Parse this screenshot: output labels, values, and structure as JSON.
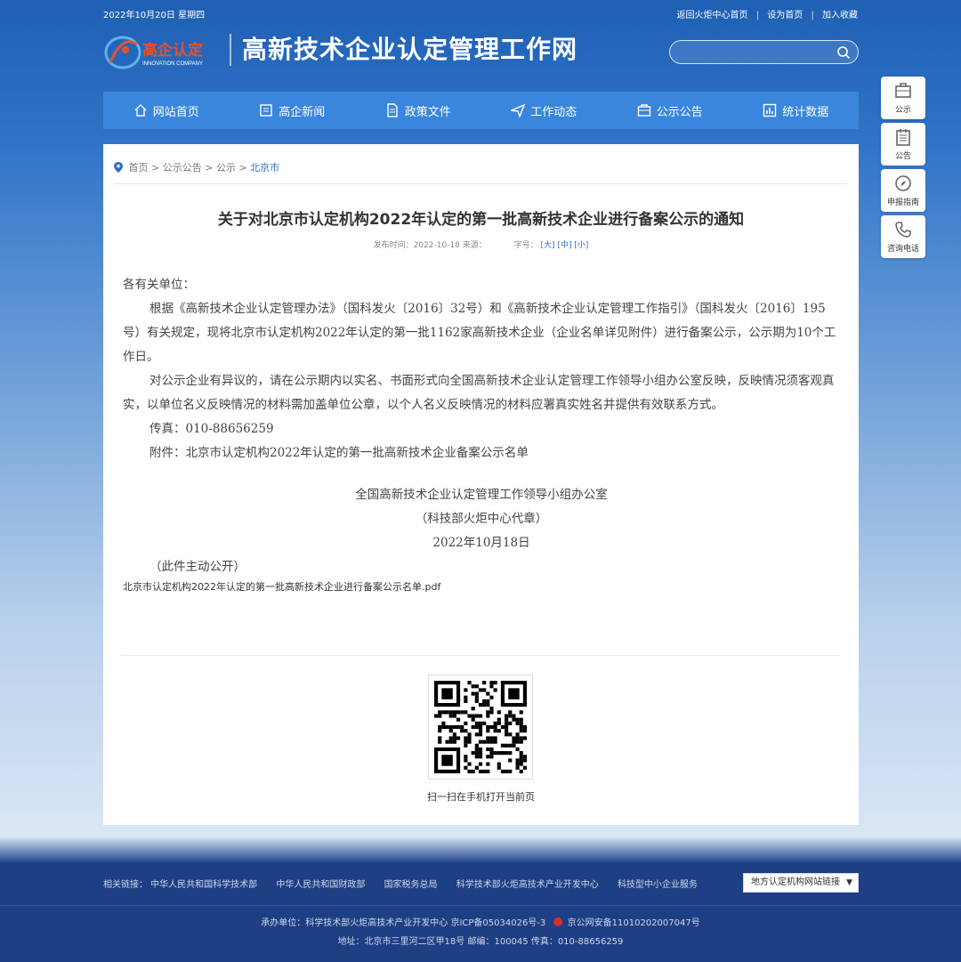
{
  "topbar": {
    "date": "2022年10月20日 星期四",
    "links": [
      "返回火炬中心首页",
      "设为首页",
      "加入收藏"
    ]
  },
  "header": {
    "logo_text": "高企认定",
    "logo_sub": "INNOVATION COMPANY",
    "site_title": "高新技术企业认定管理工作网",
    "search_placeholder": ""
  },
  "nav": [
    {
      "label": "网站首页",
      "icon": "home-icon"
    },
    {
      "label": "高企新闻",
      "icon": "news-icon"
    },
    {
      "label": "政策文件",
      "icon": "document-icon"
    },
    {
      "label": "工作动态",
      "icon": "send-icon"
    },
    {
      "label": "公示公告",
      "icon": "briefcase-icon"
    },
    {
      "label": "统计数据",
      "icon": "chart-icon"
    }
  ],
  "sidebar": [
    {
      "label": "公示",
      "icon": "briefcase-icon"
    },
    {
      "label": "公告",
      "icon": "notice-icon"
    },
    {
      "label": "申报指南",
      "icon": "compass-icon"
    },
    {
      "label": "咨询电话",
      "icon": "phone-icon"
    }
  ],
  "breadcrumb": {
    "items": [
      "首页",
      "公示公告",
      "公示"
    ],
    "current": "北京市",
    "sep": ">"
  },
  "article": {
    "title": "关于对北京市认定机构2022年认定的第一批高新技术企业进行备案公示的通知",
    "meta_date": "发布时间：2022-10-18 来源：",
    "font_label": "字号：",
    "font_sizes": [
      "[大]",
      "[中]",
      "[小]"
    ],
    "greeting": "各有关单位：",
    "para1": "根据《高新技术企业认定管理办法》（国科发火〔2016〕32号）和《高新技术企业认定管理工作指引》（国科发火〔2016〕195号）有关规定，现将北京市认定机构2022年认定的第一批1162家高新技术企业（企业名单详见附件）进行备案公示，公示期为10个工作日。",
    "para2": "对公示企业有异议的，请在公示期内以实名、书面形式向全国高新技术企业认定管理工作领导小组办公室反映，反映情况须客观真实，以单位名义反映情况的材料需加盖单位公章，以个人名义反映情况的材料应署真实姓名并提供有效联系方式。",
    "fax": "传真：010-88656259",
    "attachment_note": "附件：北京市认定机构2022年认定的第一批高新技术企业备案公示名单",
    "sign_org": "全国高新技术企业认定管理工作领导小组办公室",
    "sign_sub": "（科技部火炬中心代章）",
    "sign_date": "2022年10月18日",
    "public_note": "（此件主动公开）",
    "attachment_file": "北京市认定机构2022年认定的第一批高新技术企业进行备案公示名单.pdf"
  },
  "qr_caption": "扫一扫在手机打开当前页",
  "footer": {
    "links": [
      "相关链接： 中华人民共和国科学技术部",
      "中华人民共和国财政部",
      "国家税务总局",
      "科学技术部火炬高技术产业开发中心",
      "科技型中小企业服务"
    ],
    "select_label": "地方认定机构网站链接",
    "info1": "承办单位：科学技术部火炬高技术产业开发中心 京ICP备05034026号-3",
    "police": "京公网安备11010202007047号",
    "info2": "地址：北京市三里河二区甲18号 邮编：100045 传真：010-88656259"
  }
}
